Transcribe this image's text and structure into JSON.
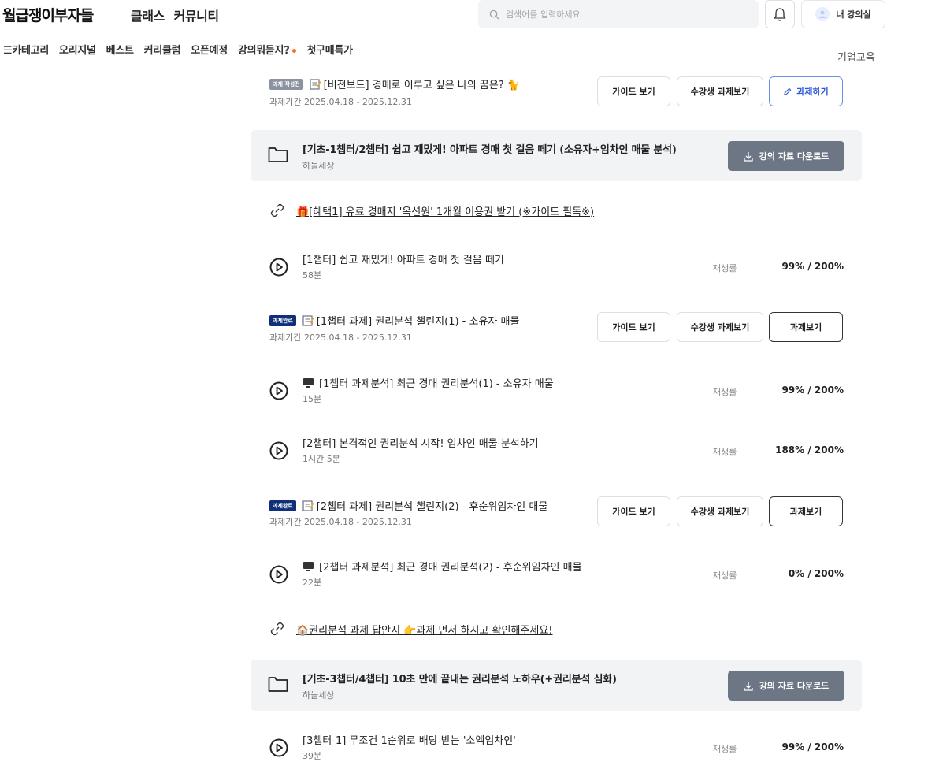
{
  "header": {
    "logo": "월급쟁이부자들",
    "nav": [
      "클래스",
      "커뮤니티"
    ],
    "search_placeholder": "검색어를 입력하세요",
    "my_course": "내 강의실",
    "subnav": [
      "☰카테고리",
      "오리지널",
      "베스트",
      "커리큘럼",
      "오픈예정",
      "강의뭐듣지?",
      "첫구매특가"
    ],
    "corporate": "기업교육"
  },
  "buttons": {
    "guide": "가이드 보기",
    "student_assign": "수강생 과제보기",
    "do_assign": "과제하기",
    "view_assign": "과제보기",
    "download": "강의 자료 다운로드",
    "replay_label": "재생률"
  },
  "items": {
    "a1": {
      "badge": "과제 작성전",
      "title": "[비전보드] 경매로 이루고 싶은 나의 꿈은? 🐈",
      "period": "과제기간 2025.04.18 - 2025.12.31"
    },
    "c1": {
      "title": "[기초-1챕터/2챕터] 쉽고 재밌게! 아파트 경매 첫 걸음 떼기 (소유자+임차인 매물 분석)",
      "sub": "하늘세상"
    },
    "k1": {
      "text": "🎁[혜택1] 유료 경매지 '옥션원' 1개월 이용권 받기 (※가이드 필독※)"
    },
    "l1": {
      "title": "[1챕터] 쉽고 재밌게! 아파트 경매 첫 걸음 떼기",
      "dur": "58분",
      "rate": "99% / 200%"
    },
    "a2": {
      "badge": "과제완료",
      "title": "[1챕터 과제] 권리분석 챌린지(1) - 소유자 매물",
      "period": "과제기간 2025.04.18 - 2025.12.31"
    },
    "l2": {
      "title": "[1챕터 과제분석] 최근 경매 권리분석(1) - 소유자 매물",
      "dur": "15분",
      "rate": "99% / 200%"
    },
    "l3": {
      "title": "[2챕터] 본격적인 권리분석 시작! 임차인 매물 분석하기",
      "dur": "1시간 5분",
      "rate": "188% / 200%"
    },
    "a3": {
      "badge": "과제완료",
      "title": "[2챕터 과제] 권리분석 챌린지(2) - 후순위임차인 매물",
      "period": "과제기간 2025.04.18 - 2025.12.31"
    },
    "l4": {
      "title": "[2챕터 과제분석] 최근 경매 권리분석(2) - 후순위임차인 매물",
      "dur": "22분",
      "rate": "0% / 200%"
    },
    "k2": {
      "text": "🏠권리분석 과제 답안지 👉과제 먼저 하시고 확인해주세요!"
    },
    "c2": {
      "title": "[기초-3챕터/4챕터] 10초 만에 끝내는 권리분석 노하우(+권리분석 심화)",
      "sub": "하늘세상"
    },
    "l5": {
      "title": "[3챕터-1] 무조건 1순위로 배당 받는 '소액임차인'",
      "dur": "39분",
      "rate": "99% / 200%"
    }
  },
  "colors": {
    "done_badge": "#102f7a",
    "pre_badge": "#8b93a1",
    "download_btn": "#6c7684",
    "primary_blue": "#2f5ad6",
    "new_dot": "#ff6b2c"
  }
}
